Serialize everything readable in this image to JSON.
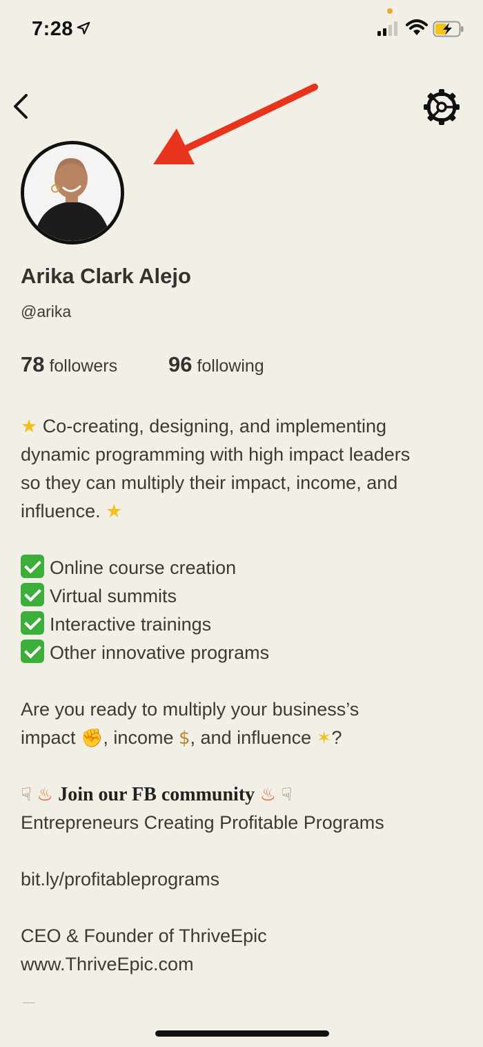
{
  "status_bar": {
    "time": "7:28",
    "icons": [
      "location-arrow-icon",
      "signal-icon",
      "wifi-icon",
      "battery-charging-icon"
    ]
  },
  "nav": {
    "back_icon": "chevron-left-icon",
    "settings_icon": "gear-icon"
  },
  "profile": {
    "name": "Arika Clark Alejo",
    "handle": "@arika",
    "followers_count": "78",
    "followers_label": "followers",
    "following_count": "96",
    "following_label": "following"
  },
  "bio": {
    "intro_l1": "Co-creating, designing, and implementing",
    "intro_l2": "dynamic programming with high impact leaders",
    "intro_l3": "so they can multiply their impact, income, and",
    "intro_l4": "influence.",
    "checklist": [
      "Online course creation",
      "Virtual summits",
      "Interactive trainings",
      "Other innovative programs"
    ],
    "question_l1": "Are you ready to multiply your business’s",
    "question_impact": "impact",
    "question_income": ", income",
    "question_influence": ", and influence",
    "question_end": "?",
    "fb_heading": "Join our FB community",
    "fb_group": "Entrepreneurs Creating Profitable Programs",
    "link": "bit.ly/profitableprograms",
    "role": "CEO & Founder of ThriveEpic",
    "website": "www.ThriveEpic.com"
  },
  "colors": {
    "background": "#f1efe6",
    "annotation_arrow": "#e8341c",
    "check_green": "#3cae3a"
  }
}
